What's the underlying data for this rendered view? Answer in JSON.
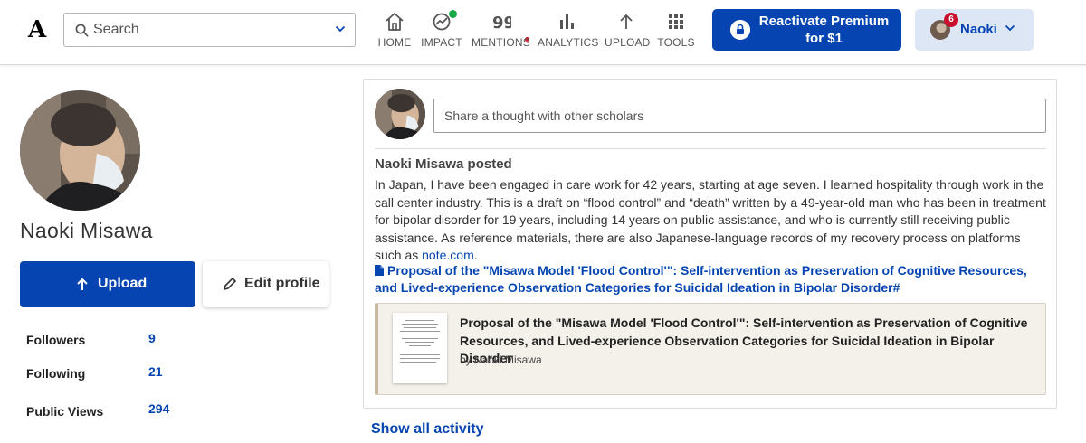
{
  "header": {
    "logo": "A",
    "search": {
      "placeholder": "Search",
      "value": ""
    },
    "nav": [
      {
        "label": "HOME",
        "icon": "home-icon"
      },
      {
        "label": "IMPACT",
        "icon": "impact-icon"
      },
      {
        "label": "MENTIONS",
        "icon": "quote-icon"
      },
      {
        "label": "ANALYTICS",
        "icon": "bar-chart-icon"
      },
      {
        "label": "UPLOAD",
        "icon": "arrow-up-icon"
      },
      {
        "label": "TOOLS",
        "icon": "grid-icon"
      }
    ],
    "premium": {
      "line1": "Reactivate Premium",
      "line2": "for $1"
    },
    "user": {
      "name": "Naoki",
      "notifications": "6"
    }
  },
  "profile": {
    "name": "Naoki Misawa",
    "upload_label": "Upload",
    "edit_label": "Edit profile",
    "stats": [
      {
        "label": "Followers",
        "value": "9"
      },
      {
        "label": "Following",
        "value": "21"
      },
      {
        "label": "Public Views",
        "value": "294"
      }
    ]
  },
  "feed": {
    "input_placeholder": "Share a thought with other scholars",
    "poster": "Naoki Misawa posted",
    "body_text": "In Japan, I have been engaged in care work for 42 years, starting at age seven. I learned hospitality through work in the call center industry. This is a draft on “flood control” and “death” written by a 49-year-old man who has been in treatment for bipolar disorder for 19 years, including 14 years on public assistance, and who is currently still receiving public assistance. As reference materials, there are also Japanese-language records of my recovery process on platforms such as ",
    "body_link": "note.com",
    "body_end": ".",
    "paper_link": "Proposal of the \"Misawa Model 'Flood Control'\": Self-intervention as Preservation of Cognitive Resources, and Lived-experience Observation Categories for Suicidal Ideation in Bipolar Disorder#",
    "paper_title": "Proposal of the \"Misawa Model 'Flood Control'\": Self-intervention as Preservation of Cognitive Resources, and Lived-experience Observation Categories for Suicidal Ideation in Bipolar Disorder",
    "paper_author": "by Naoki Misawa",
    "show_all": "Show all activity"
  }
}
